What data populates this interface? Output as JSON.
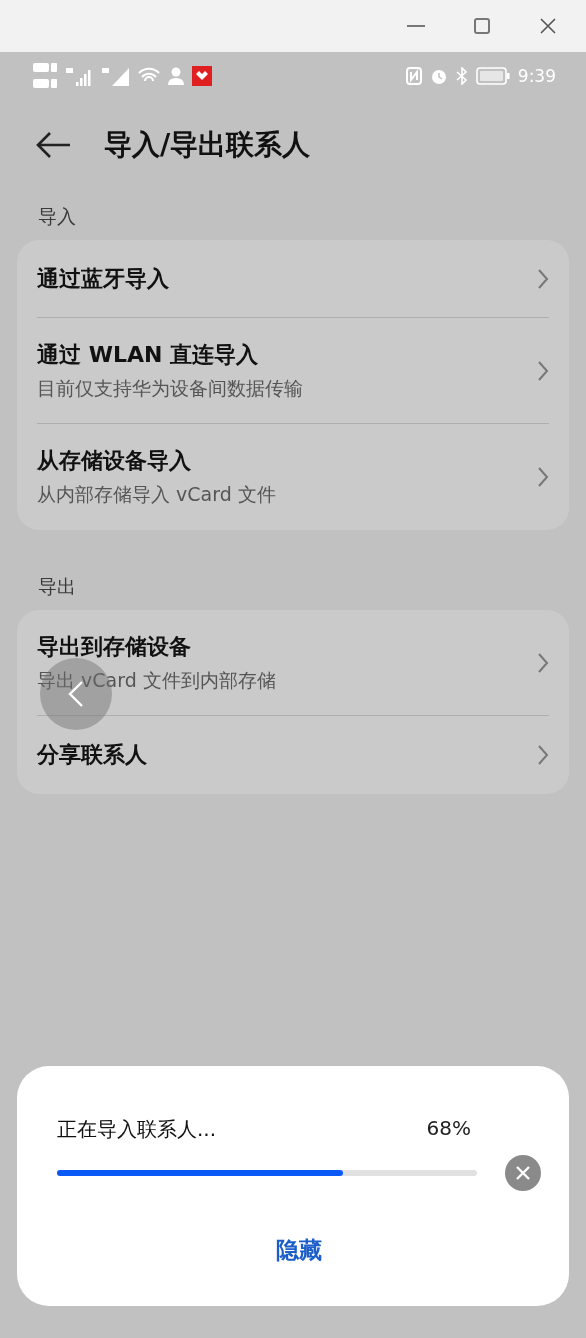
{
  "status_bar": {
    "time": "9:39"
  },
  "header": {
    "title": "导入/导出联系人"
  },
  "sections": [
    {
      "title": "导入",
      "items": [
        {
          "title": "通过蓝牙导入"
        },
        {
          "title": "通过 WLAN 直连导入",
          "subtitle": "目前仅支持华为设备间数据传输"
        },
        {
          "title": "从存储设备导入",
          "subtitle": "从内部存储导入 vCard 文件"
        }
      ]
    },
    {
      "title": "导出",
      "items": [
        {
          "title": "导出到存储设备",
          "subtitle": "导出 vCard 文件到内部存储"
        },
        {
          "title": "分享联系人"
        }
      ]
    }
  ],
  "progress_dialog": {
    "message": "正在导入联系人...",
    "percent": "68%",
    "level": 0.68,
    "button": "隐藏"
  }
}
